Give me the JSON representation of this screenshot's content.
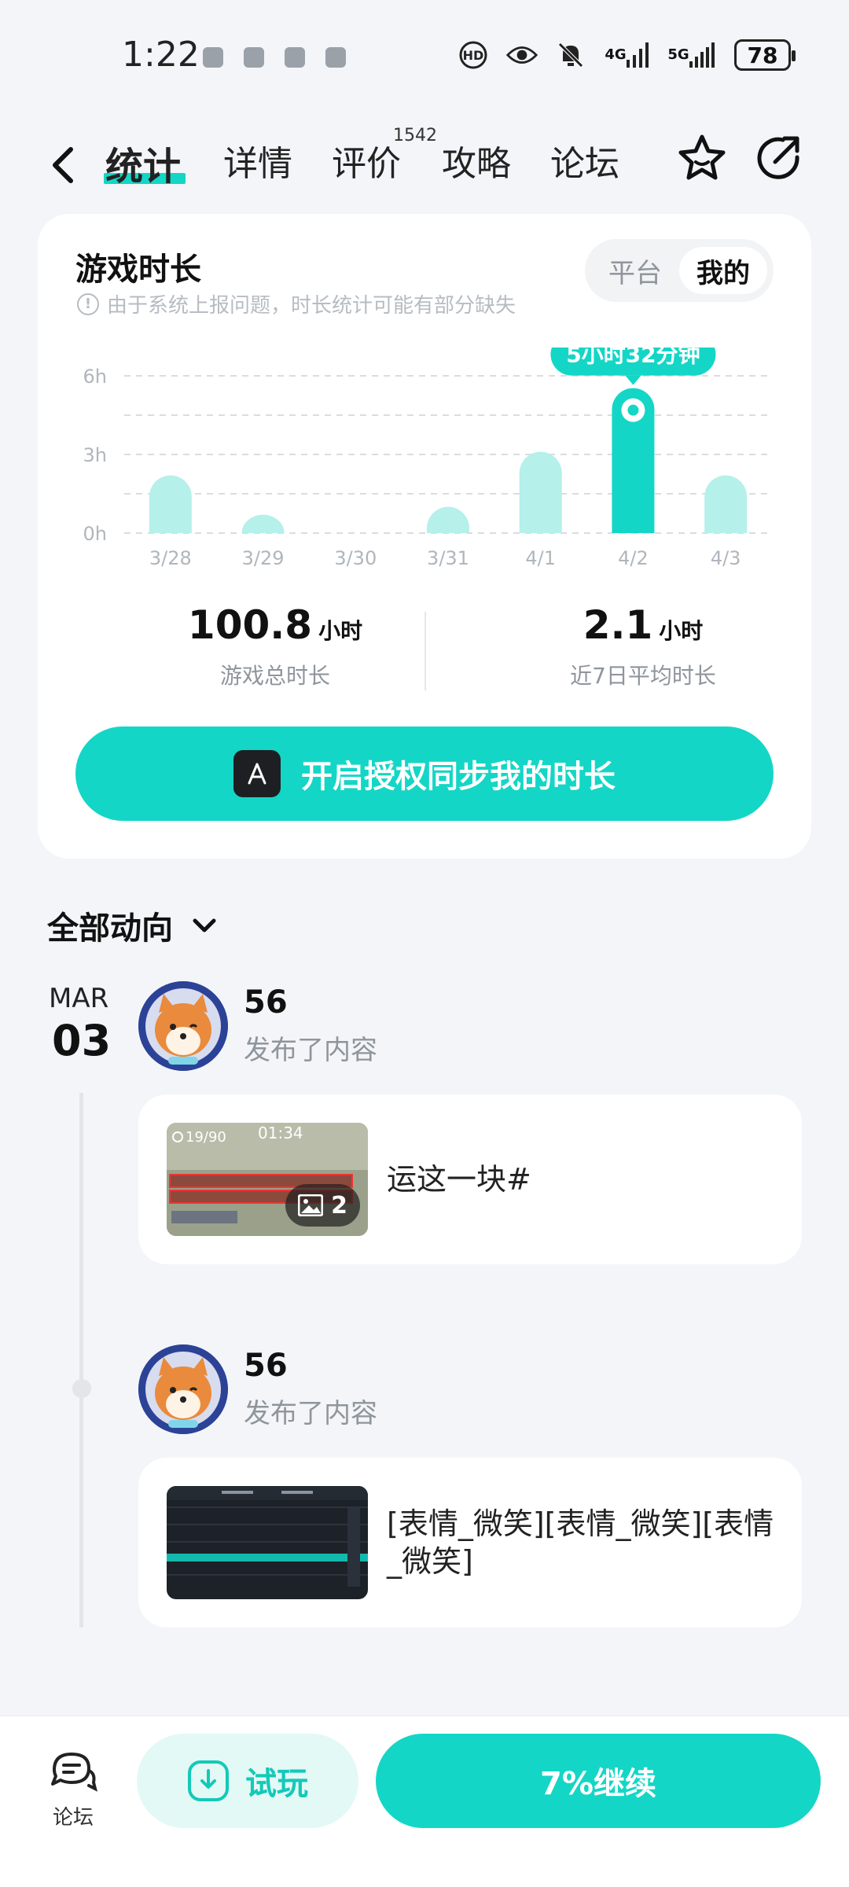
{
  "status_bar": {
    "time": "1:22",
    "battery": "78",
    "net1": "4G",
    "net2": "5G"
  },
  "nav": {
    "tabs": [
      {
        "label": "统计"
      },
      {
        "label": "详情"
      },
      {
        "label": "评价"
      },
      {
        "label": "攻略"
      },
      {
        "label": "论坛"
      }
    ],
    "review_count": "1542"
  },
  "playtime": {
    "title": "游戏时长",
    "note": "由于系统上报问题，时长统计可能有部分缺失",
    "toggle": {
      "platform": "平台",
      "mine": "我的",
      "selected": "我的"
    },
    "highlight_label": "5小时32分钟",
    "total_value": "100.8",
    "total_unit": "小时",
    "total_label": "游戏总时长",
    "avg_value": "2.1",
    "avg_unit": "小时",
    "avg_label": "近7日平均时长",
    "sync_button": "开启授权同步我的时长"
  },
  "chart_data": {
    "type": "bar",
    "categories": [
      "3/28",
      "3/29",
      "3/30",
      "3/31",
      "4/1",
      "4/2",
      "4/3"
    ],
    "values": [
      2.2,
      0.7,
      0,
      1.0,
      3.1,
      5.53,
      2.2
    ],
    "y_ticks": [
      "0h",
      "3h",
      "6h"
    ],
    "ylim": [
      0,
      6
    ],
    "highlight_index": 5,
    "colors": {
      "bar": "#b5f0ea",
      "highlight": "#14d6c6",
      "grid": "#d9dde1",
      "tick": "#b0b6bc"
    }
  },
  "feed": {
    "header": "全部动向",
    "date_month": "MAR",
    "date_day": "03",
    "posts": [
      {
        "user": "56",
        "action": "发布了内容",
        "text": "运这一块#",
        "image_count": "2",
        "thumb_timer": "01:34",
        "thumb_score": "19/90"
      },
      {
        "user": "56",
        "action": "发布了内容",
        "text": "[表情_微笑][表情_微笑][表情_微笑]"
      }
    ]
  },
  "bottom_bar": {
    "forum_label": "论坛",
    "trial_label": "试玩",
    "continue_label": "7%继续"
  },
  "colors": {
    "accent": "#14d6c6",
    "accent_light": "#e3f9f6"
  }
}
